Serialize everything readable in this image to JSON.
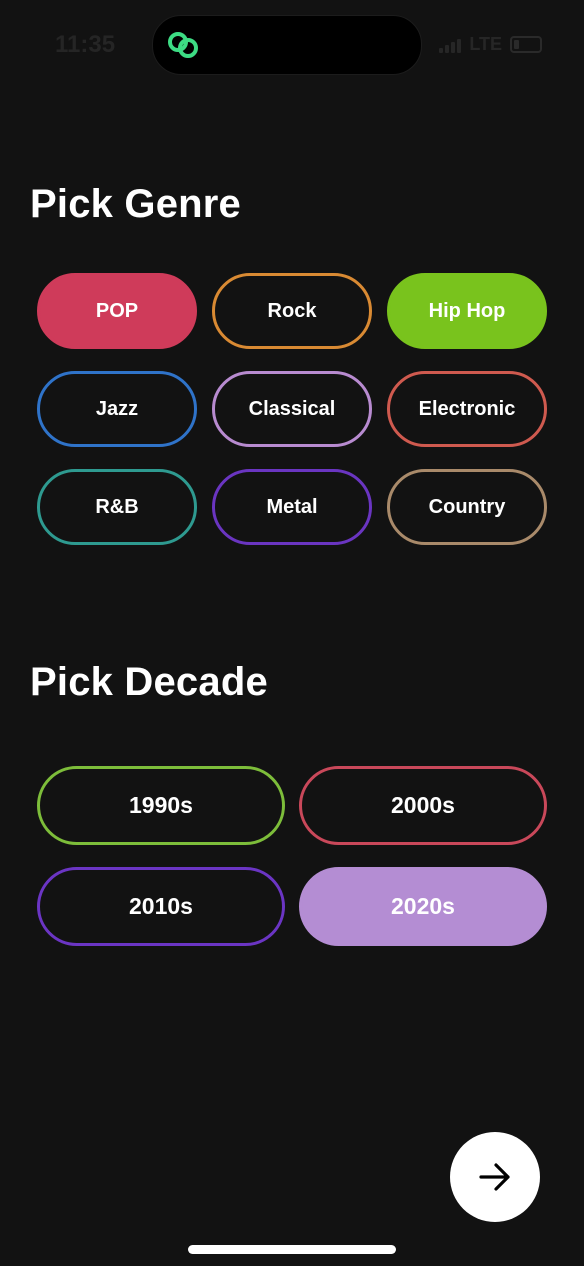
{
  "status": {
    "time": "11:35",
    "network": "LTE",
    "app_icon": "linked-rings-icon",
    "icon_color": "#3ddc84"
  },
  "genre": {
    "title": "Pick Genre",
    "options": [
      {
        "label": "POP",
        "color": "#cf3b5a",
        "selected": true
      },
      {
        "label": "Rock",
        "color": "#d98a33",
        "selected": false
      },
      {
        "label": "Hip Hop",
        "color": "#79c31d",
        "selected": true
      },
      {
        "label": "Jazz",
        "color": "#2f73c9",
        "selected": false
      },
      {
        "label": "Classical",
        "color": "#b88bd0",
        "selected": false
      },
      {
        "label": "Electronic",
        "color": "#cf5a4f",
        "selected": false
      },
      {
        "label": "R&B",
        "color": "#2e9a90",
        "selected": false
      },
      {
        "label": "Metal",
        "color": "#6a35c1",
        "selected": false
      },
      {
        "label": "Country",
        "color": "#a98a6a",
        "selected": false
      }
    ]
  },
  "decade": {
    "title": "Pick Decade",
    "options": [
      {
        "label": "1990s",
        "color": "#7dbd3a",
        "selected": false
      },
      {
        "label": "2000s",
        "color": "#c9485a",
        "selected": false
      },
      {
        "label": "2010s",
        "color": "#6b35c4",
        "selected": false
      },
      {
        "label": "2020s",
        "color": "#b48dd3",
        "selected": true
      }
    ]
  },
  "next_icon": "arrow-right-icon"
}
